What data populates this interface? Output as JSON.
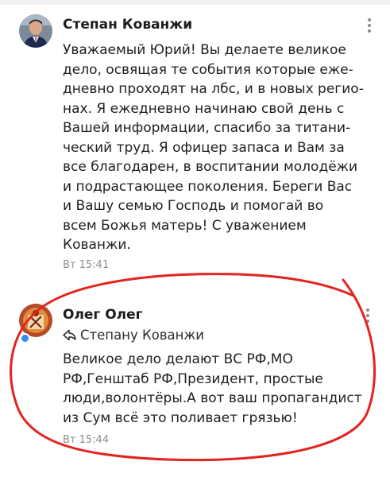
{
  "comments": [
    {
      "author": "Степан Кованжи",
      "lines": [
        "Уважаемый Юрий! Вы делаете великое",
        "дело, освящая те события которые еже-",
        "дневно проходят на лбс, и в новых регио-",
        "нах. Я ежедневно начинаю свой день с",
        "Вашей информации, спасибо за титани-",
        "ческий труд. Я офицер запаса и Вам за",
        "все благодарен, в воспитании молодёжи",
        "и подрастающее поколения. Береги Вас",
        "и Вашу семью Господь и помогай во",
        "всем Божья матерь! С уважением",
        "Кованжи."
      ],
      "time": "Вт 15:41"
    },
    {
      "author": "Олег Олег",
      "reply_to": "Степану Кованжи",
      "lines": [
        "Великое дело делают ВС РФ,МО",
        "РФ,Генштаб РФ,Президент, простые",
        "люди,волонтёры.А вот ваш пропагандист",
        "из Сум всё это поливает грязью!"
      ],
      "time": "Вт 15:44"
    }
  ],
  "colors": {
    "text": "#1f1f1f",
    "timestamp": "#8e8e93",
    "online": "#2f8bf0",
    "annotation": "#e3231f"
  },
  "icons": {
    "menu": "more-vertical-icon",
    "reply": "reply-arrow-icon"
  }
}
